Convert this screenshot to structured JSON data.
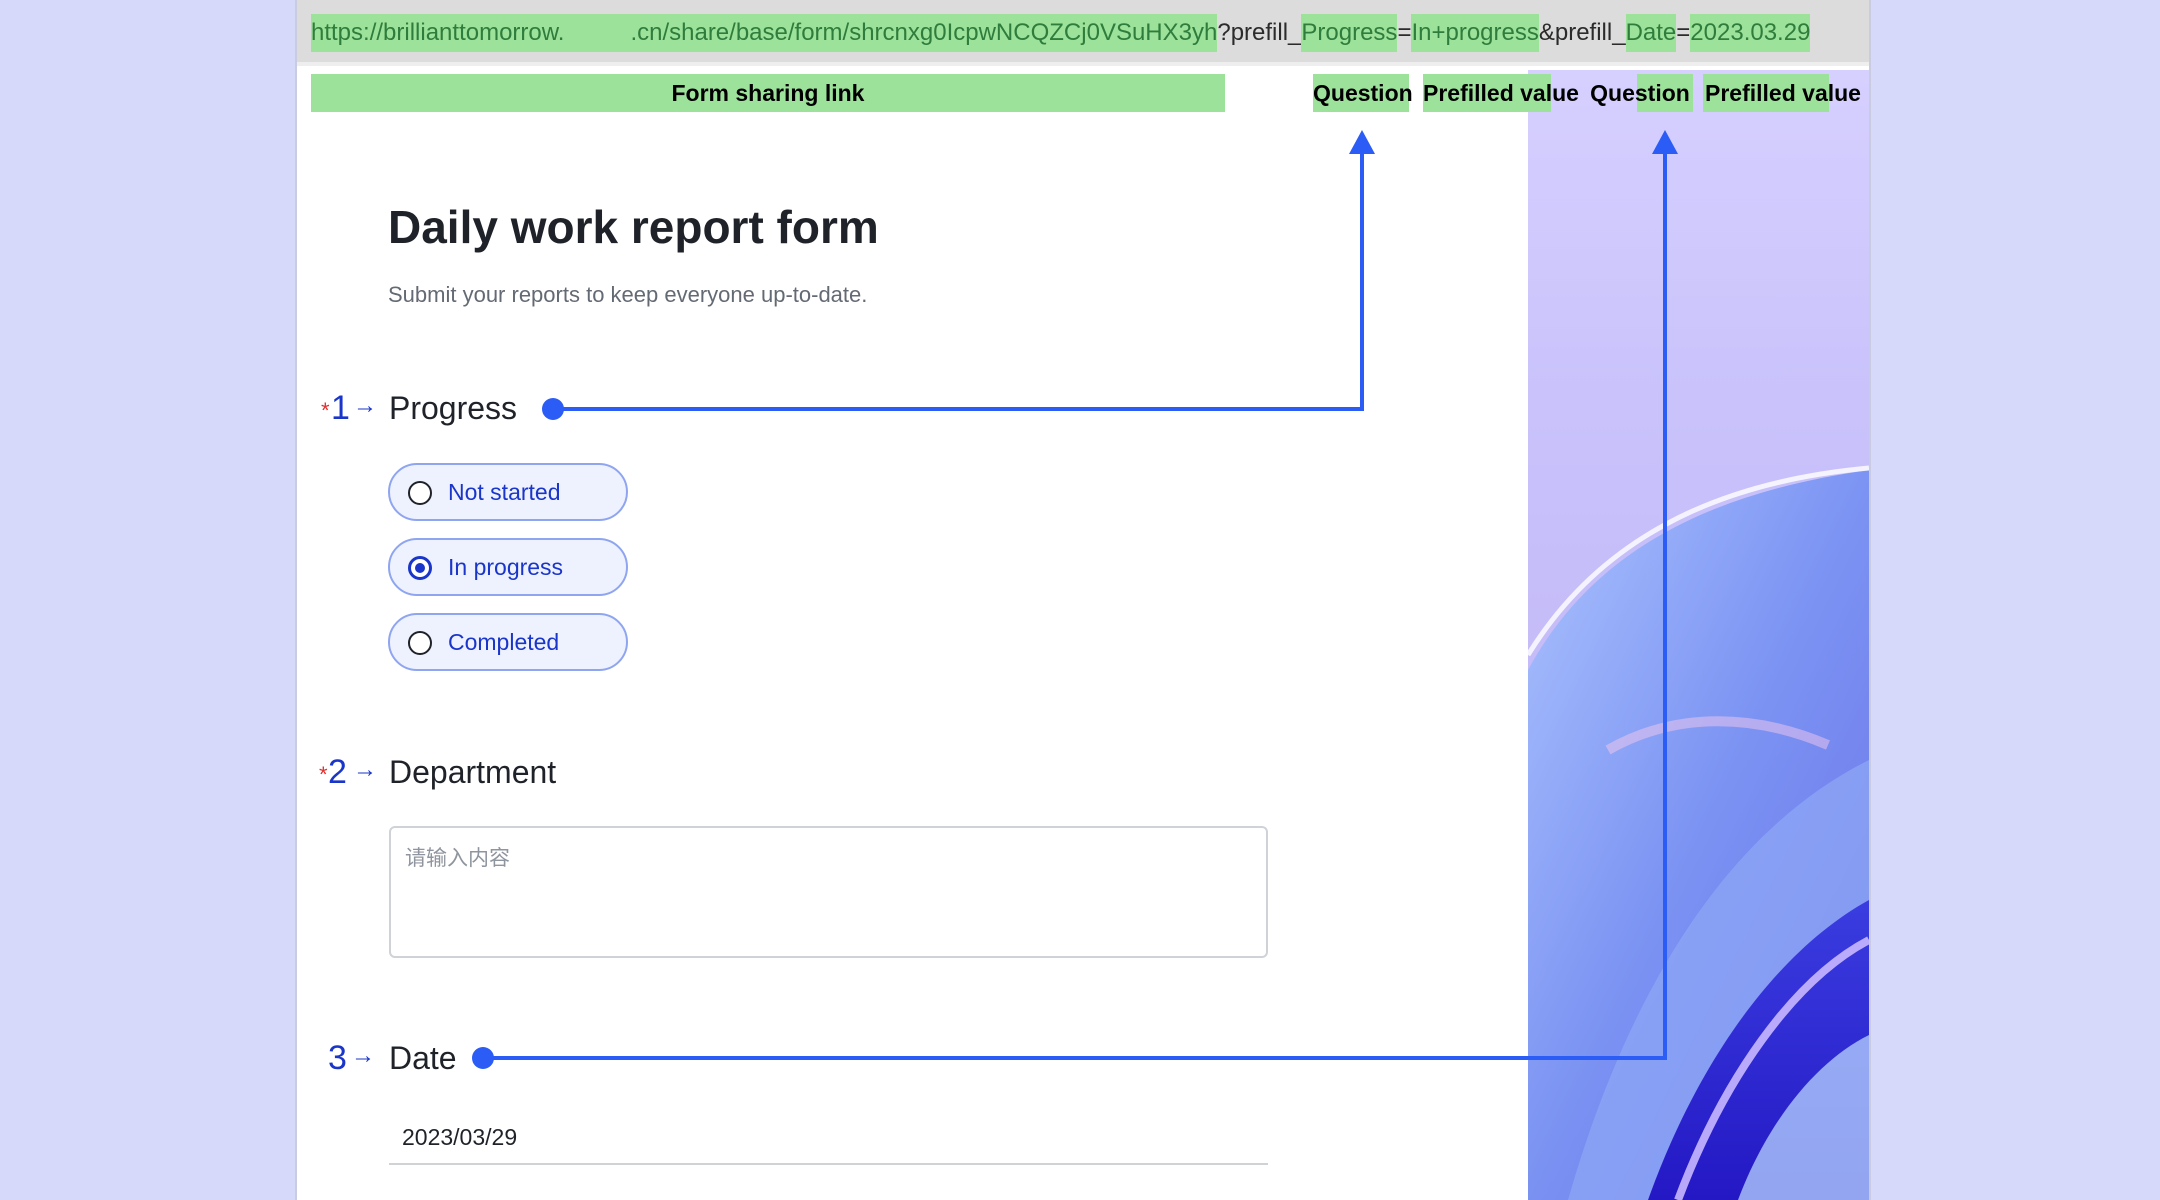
{
  "url": {
    "part1": "https://brillianttomorrow.",
    "part2": ".cn/share/base/form/shrcnxg0IcpwNCQZCj0VSuHX3yh",
    "part3": "?prefill_",
    "question1": "Progress",
    "eq1": "=",
    "value1": "In+progress",
    "part4": "&prefill_",
    "question2": "Date",
    "eq2": "=",
    "value2": "2023.03.29"
  },
  "labels": {
    "sharing_link": "Form sharing link",
    "question_a": "Question",
    "prefilled_a": "Prefilled value",
    "question_b": "Question",
    "prefilled_b": "Prefilled value"
  },
  "form": {
    "title": "Daily work report form",
    "subtitle": "Submit your reports to keep everyone up-to-date."
  },
  "questions": [
    {
      "number": "1",
      "required": "*",
      "arrow": "→",
      "title": "Progress",
      "options": [
        {
          "label": "Not started",
          "selected": false
        },
        {
          "label": "In progress",
          "selected": true
        },
        {
          "label": "Completed",
          "selected": false
        }
      ]
    },
    {
      "number": "2",
      "required": "*",
      "arrow": "→",
      "title": "Department",
      "placeholder": "请输入内容"
    },
    {
      "number": "3",
      "arrow": "→",
      "title": "Date",
      "value": "2023/03/29"
    }
  ],
  "colors": {
    "highlight": "#9de29a",
    "connector": "#2b5cf5",
    "accent": "#1a35c9"
  }
}
